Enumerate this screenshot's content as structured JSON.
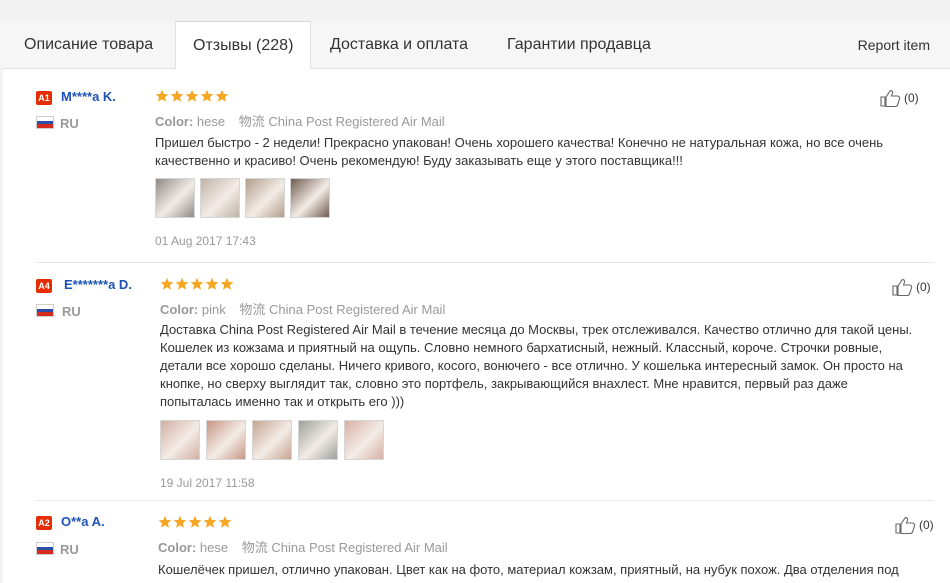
{
  "tabs": [
    {
      "label": "Описание товара"
    },
    {
      "label": "Отзывы (228)"
    },
    {
      "label": "Доставка и оплата"
    },
    {
      "label": "Гарантии продавца"
    }
  ],
  "report_label": "Report item",
  "star_color": "#f5a623",
  "badge_color": "#e62e04",
  "name_color": "#1d52b7",
  "flag_icon": "russia-flag-icon",
  "like_icon": "thumbs-up-icon",
  "reviews": [
    {
      "badge": "A1",
      "name": "M****a K.",
      "country": "RU",
      "rating": 5,
      "color_label": "Color:",
      "color_value": "hese",
      "shipping_label": "物流",
      "shipping_value": "China Post Registered Air Mail",
      "text": "Пришел быстро - 2 недели! Прекрасно упакован! Очень хорошего качества! Конечно не натуральная кожа, но все очень качественно и красиво! Очень рекомендую! Буду заказывать еще у этого поставщика!!!",
      "thumbs": [
        "#8f8a86",
        "#bfb3a6",
        "#b19e8c",
        "#6f5b50"
      ],
      "date": "01 Aug 2017 17:43",
      "likes": "(0)"
    },
    {
      "badge": "A4",
      "name": "E*******a D.",
      "country": "RU",
      "rating": 5,
      "color_label": "Color:",
      "color_value": "pink",
      "shipping_label": "物流",
      "shipping_value": "China Post Registered Air Mail",
      "text": "Доставка China Post Registered Air Mail в течение месяца до Москвы, трек отслеживался. Качество отлично для такой цены. Кошелек из кожзама и приятный на ощупь. Словно немного бархатисный, нежный. Классный, короче. Строчки ровные, детали все хорошо сделаны. Ничего кривого, косого, вонючего - все отлично. У кошелька интересный замок. Он просто на кнопке, но сверху выглядит так, словно это портфель, закрывающийся внахлест. Мне нравится, первый раз даже попыталась именно так и открыть его )))",
      "thumbs": [
        "#d2aea2",
        "#c89686",
        "#c7a491",
        "#9fa09c",
        "#d8b0a4"
      ],
      "date": "19 Jul 2017 11:58",
      "likes": "(0)"
    },
    {
      "badge": "A2",
      "name": "O**a A.",
      "country": "RU",
      "rating": 5,
      "color_label": "Color:",
      "color_value": "hese",
      "shipping_label": "物流",
      "shipping_value": "China Post Registered Air Mail",
      "text": "Кошелёчек пришел, отлично упакован. Цвет как на фото, материал кожзам, приятный, на нубук похож. Два отделения под",
      "thumbs": [],
      "date": "",
      "likes": "(0)"
    }
  ]
}
